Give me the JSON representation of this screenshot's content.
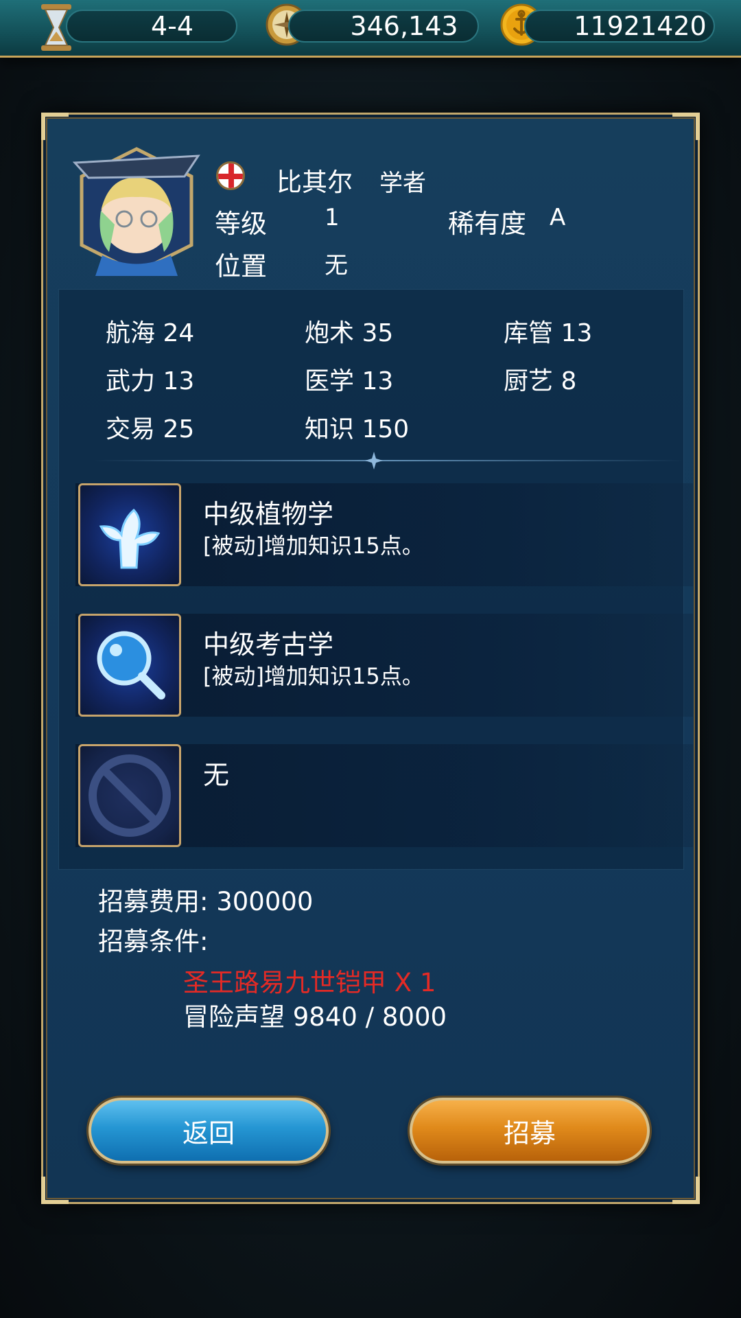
{
  "topbar": {
    "stage": "4-4",
    "compass_value": "346,143",
    "gold_value": "11921420"
  },
  "character": {
    "name": "比其尔",
    "class": "学者",
    "level_label": "等级",
    "level": "1",
    "rarity_label": "稀有度",
    "rarity": "A",
    "position_label": "位置",
    "position": "无",
    "flag": "england-flag"
  },
  "stats": [
    {
      "label": "航海 24"
    },
    {
      "label": "炮术 35"
    },
    {
      "label": "库管 13"
    },
    {
      "label": "武力 13"
    },
    {
      "label": "医学 13"
    },
    {
      "label": "厨艺 8"
    },
    {
      "label": "交易 25"
    },
    {
      "label": "知识 150"
    }
  ],
  "skills": [
    {
      "name": "中级植物学",
      "desc": "[被动]增加知识15点。",
      "icon": "plant-icon"
    },
    {
      "name": "中级考古学",
      "desc": "[被动]增加知识15点。",
      "icon": "magnifier-icon"
    },
    {
      "name": "无",
      "desc": "",
      "icon": "none-icon"
    }
  ],
  "recruit": {
    "cost": "招募费用: 300000",
    "condition_label": "招募条件:",
    "req_item": "圣王路易九世铠甲 X 1",
    "req_fame": "冒险声望 9840 / 8000"
  },
  "buttons": {
    "back": "返回",
    "recruit": "招募"
  },
  "colors": {
    "requirement_unmet": "#e42a25",
    "back_button": "#2596d3",
    "recruit_button": "#e08a1b",
    "frame_gold": "#c3a86c"
  }
}
